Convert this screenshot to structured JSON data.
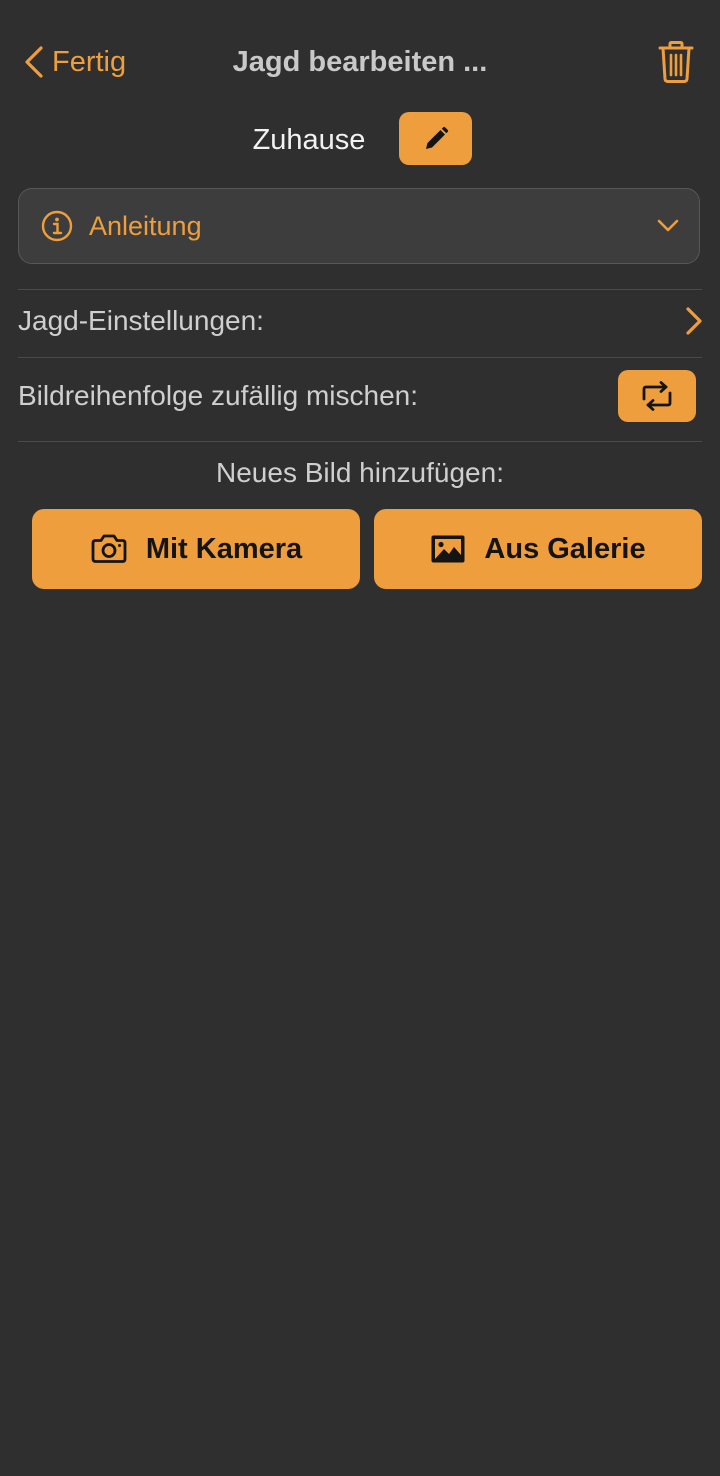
{
  "nav": {
    "back_label": "Fertig",
    "title": "Jagd bearbeiten ...",
    "back_icon": "chevron-left-icon",
    "trash_icon": "trash-icon"
  },
  "hunt": {
    "name": "Zuhause",
    "edit_icon": "pencil-icon"
  },
  "instructions": {
    "label": "Anleitung",
    "icon": "info-circle-icon",
    "expand_icon": "chevron-down-icon",
    "expanded": false
  },
  "settings": {
    "label": "Jagd-Einstellungen:",
    "icon": "chevron-right-icon"
  },
  "shuffle": {
    "label": "Bildreihenfolge zufällig mischen:",
    "icon": "shuffle-icon"
  },
  "add_image": {
    "label": "Neues Bild hinzufügen:",
    "camera_label": "Mit Kamera",
    "camera_icon": "camera-icon",
    "gallery_label": "Aus Galerie",
    "gallery_icon": "image-icon"
  },
  "colors": {
    "background": "#2f2f2f",
    "accent": "#ee9e3c",
    "text_primary": "#f2f2f2",
    "text_secondary": "#cfcfcf"
  }
}
